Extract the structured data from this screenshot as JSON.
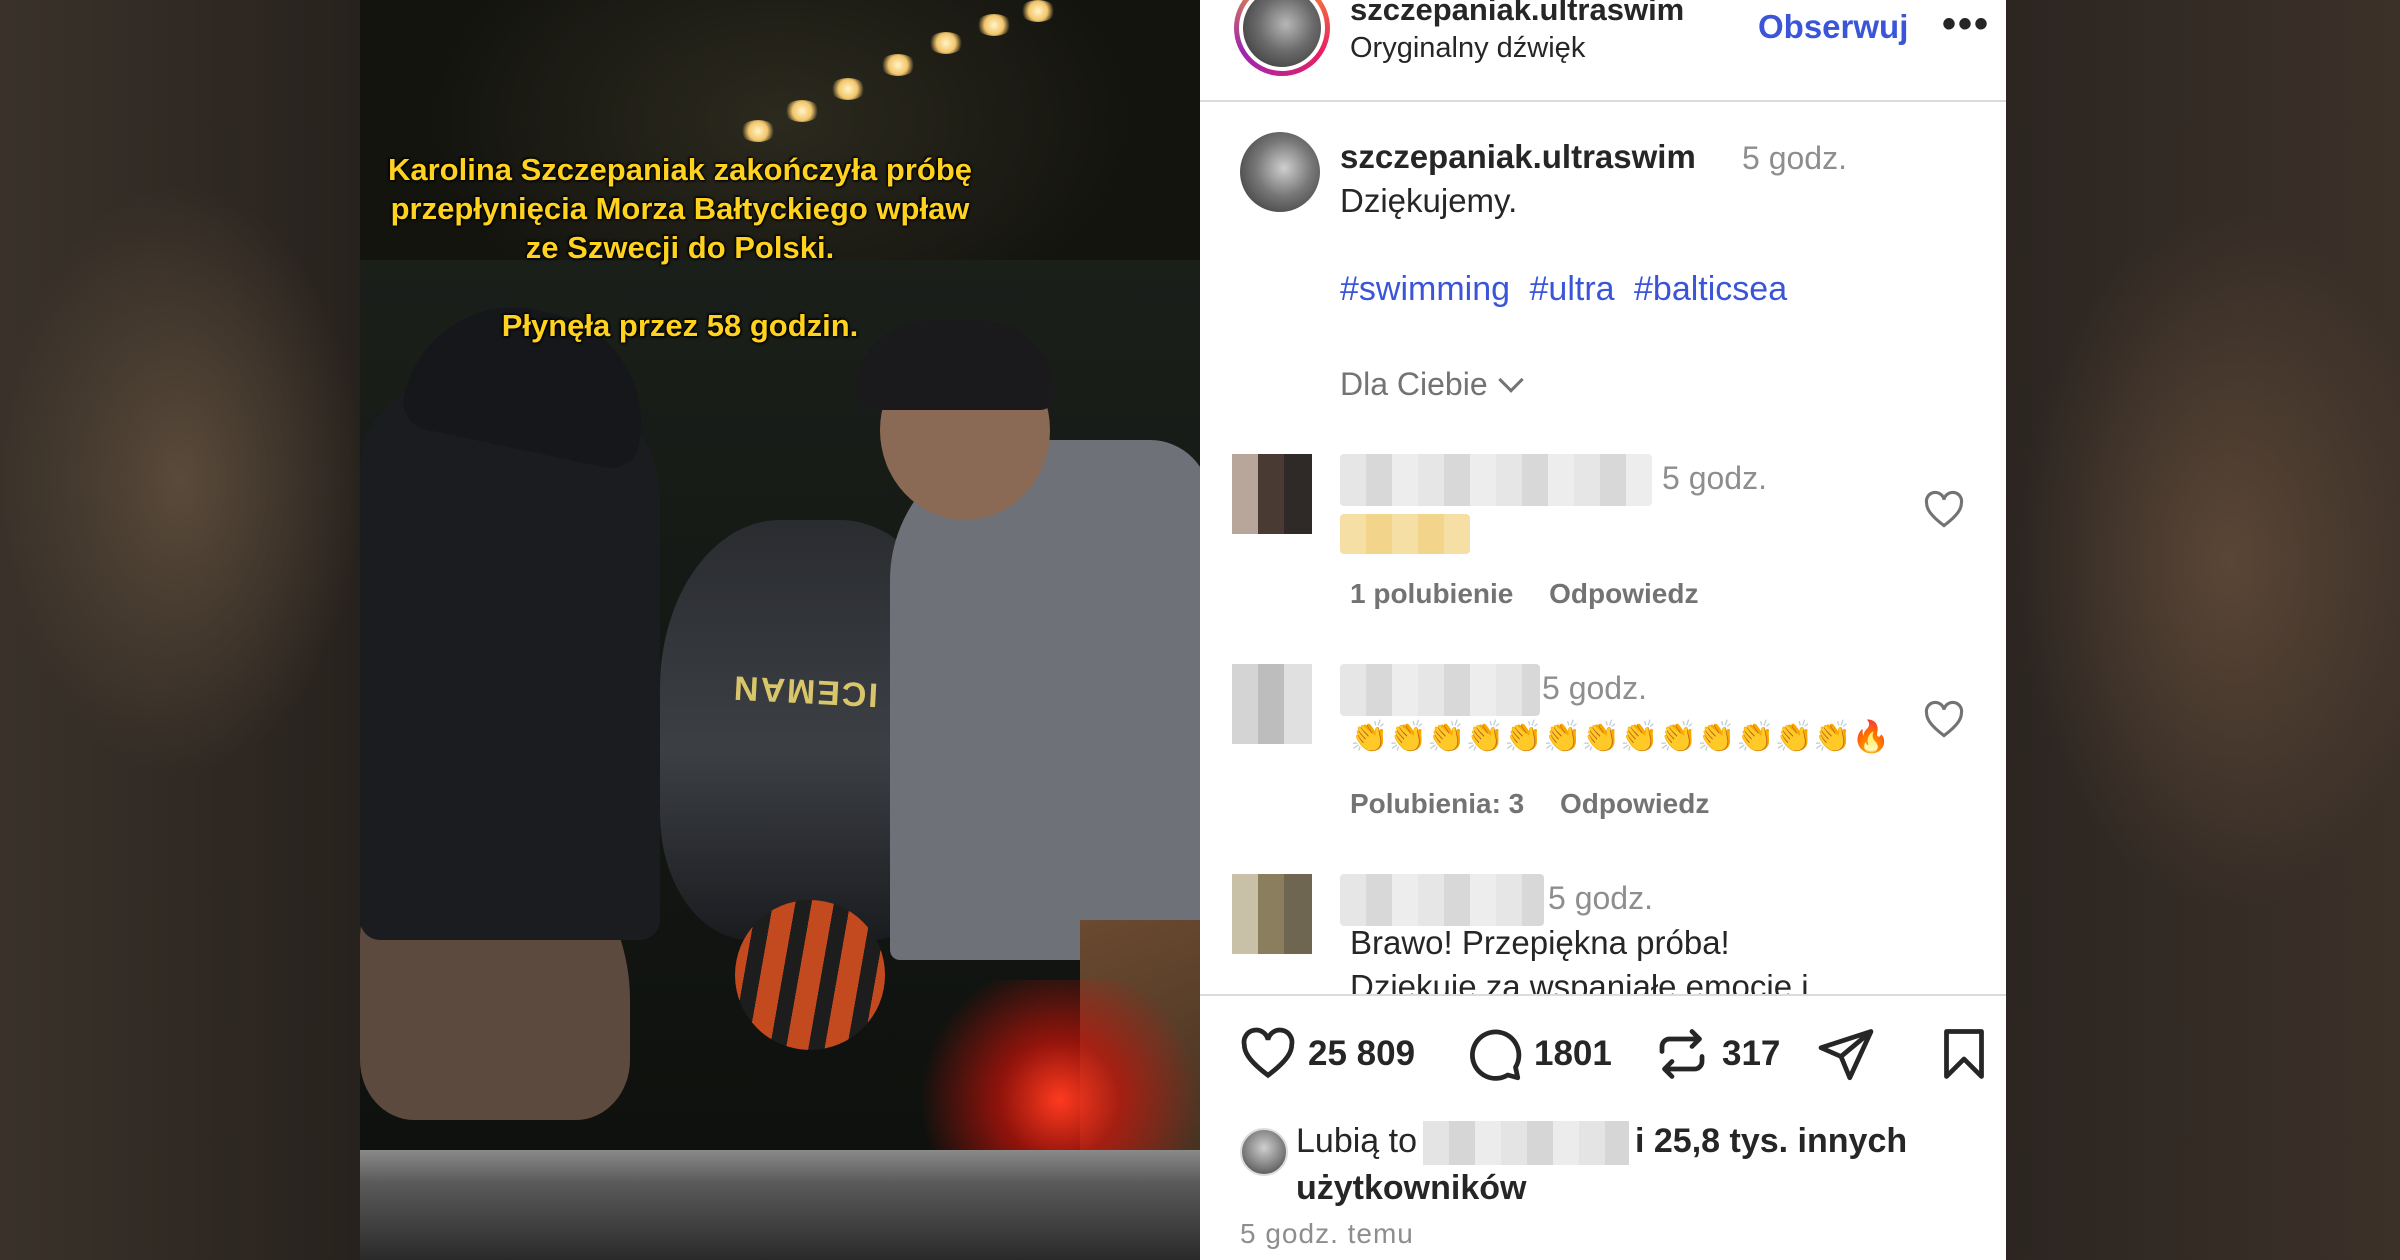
{
  "video": {
    "caption_line1": "Karolina Szczepaniak zakończyła próbę przepłynięcia Morza Bałtyckiego wpław ze Szwecji do Polski.",
    "caption_line2": "Płynęła przez 58 godzin.",
    "suit_label": "ICEMAN"
  },
  "header": {
    "username": "szczepaniak.ultraswim",
    "audio": "Oryginalny dźwięk",
    "follow_label": "Obserwuj",
    "more_label": "•••"
  },
  "post": {
    "username": "szczepaniak.ultraswim",
    "time": "5 godz.",
    "text": "Dziękujemy.",
    "hashtags": [
      "#swimming",
      "#ultra",
      "#balticsea"
    ],
    "for_you_label": "Dla Ciebie"
  },
  "comments": [
    {
      "time": "5 godz.",
      "text": "",
      "likes": "1 polubienie",
      "reply": "Odpowiedz"
    },
    {
      "time": "5 godz.",
      "text": "👏👏👏👏👏👏👏👏👏👏👏👏👏🔥",
      "likes": "Polubienia: 3",
      "reply": "Odpowiedz"
    },
    {
      "time": "5 godz.",
      "text": "Brawo! Przepiękna próba!",
      "text2": "Dziękuję za wspaniałe emocje i",
      "likes": "",
      "reply": ""
    }
  ],
  "actions": {
    "likes_count": "25 809",
    "comments_count": "1801",
    "reposts_count": "317"
  },
  "likes_summary": {
    "prefix": "Lubią to",
    "suffix": "i 25,8 tys. innych",
    "suffix2": "użytkowników"
  },
  "timestamp": "5 godz. temu",
  "colors": {
    "link_blue": "#3b55d9",
    "caption_yellow": "#ffd21f",
    "muted": "#8e8e8e"
  },
  "icons": [
    "heart-icon",
    "comment-icon",
    "repost-icon",
    "share-icon",
    "bookmark-icon",
    "chevron-down-icon",
    "more-icon"
  ]
}
